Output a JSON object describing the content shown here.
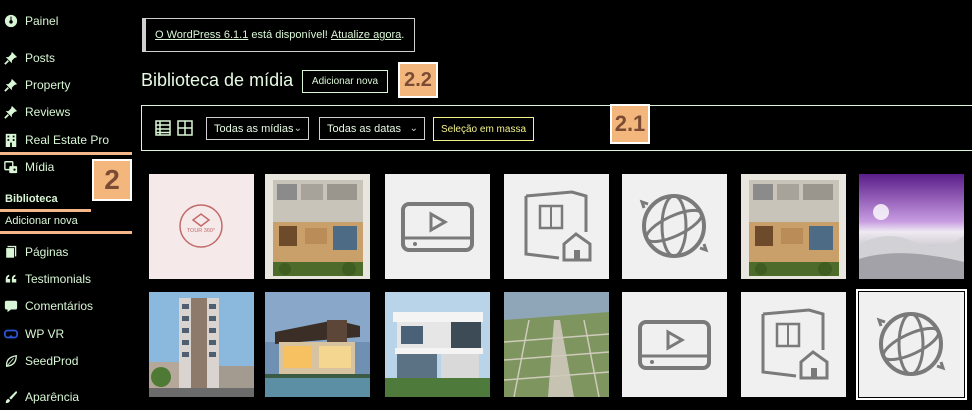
{
  "sidebar": {
    "items": [
      {
        "label": "Painel",
        "icon": "dashboard-icon"
      },
      {
        "label": "Posts",
        "icon": "pin-icon"
      },
      {
        "label": "Property",
        "icon": "pin-icon"
      },
      {
        "label": "Reviews",
        "icon": "pin-icon"
      },
      {
        "label": "Real Estate Pro",
        "icon": "building-icon"
      },
      {
        "label": "Mídia",
        "icon": "media-icon"
      },
      {
        "label": "Páginas",
        "icon": "pages-icon"
      },
      {
        "label": "Testimonials",
        "icon": "quote-icon"
      },
      {
        "label": "Comentários",
        "icon": "comment-icon"
      },
      {
        "label": "WP VR",
        "icon": "vr-icon"
      },
      {
        "label": "SeedProd",
        "icon": "leaf-icon"
      },
      {
        "label": "Aparência",
        "icon": "brush-icon"
      }
    ],
    "submenu": {
      "library": "Biblioteca",
      "add_new": "Adicionar nova"
    }
  },
  "badges": {
    "media": "2",
    "add_new": "2.2",
    "bulk": "2.1"
  },
  "notice": {
    "link_version": "O WordPress 6.1.1",
    "middle": " está disponível! ",
    "link_update": "Atualize agora",
    "end": "."
  },
  "header": {
    "title": "Biblioteca de mídia",
    "add_new_button": "Adicionar nova"
  },
  "filters": {
    "media_type": "Todas as mídias",
    "dates": "Todas as datas",
    "bulk_select": "Seleção em massa"
  },
  "grid": {
    "items": [
      {
        "type": "tour360",
        "label": "TOUR 360°"
      },
      {
        "type": "floorplan-photo"
      },
      {
        "type": "video-icon"
      },
      {
        "type": "floorplan-icon"
      },
      {
        "type": "vr-icon"
      },
      {
        "type": "floorplan-photo"
      },
      {
        "type": "panorama"
      },
      {
        "type": "building-photo"
      },
      {
        "type": "house-photo"
      },
      {
        "type": "modern-house-photo"
      },
      {
        "type": "aerial-photo"
      },
      {
        "type": "video-icon"
      },
      {
        "type": "floorplan-icon"
      },
      {
        "type": "vr-icon"
      }
    ]
  },
  "colors": {
    "accent": "#d9f7d6",
    "badge": "#f3b77d",
    "bulk": "#f4f28a",
    "tile_bg": "#f0f0f0",
    "tour_bg": "#f6e9e9"
  }
}
